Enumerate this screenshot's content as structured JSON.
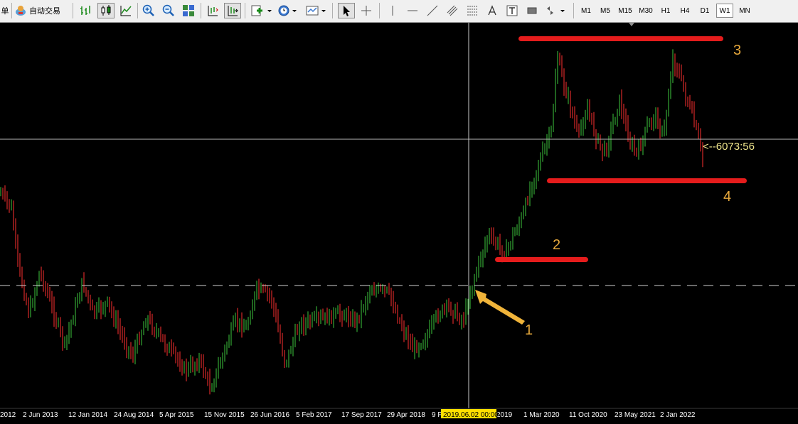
{
  "toolbar": {
    "menu_fragment": "单",
    "autotrade_label": "自动交易",
    "icons": [
      "autotrade-icon",
      "bar-chart-icon",
      "candlestick-icon",
      "line-chart-icon",
      "zoom-in-icon",
      "zoom-out-icon",
      "tile-windows-icon",
      "chart-shift-icon",
      "autoscroll-icon",
      "new-chart-icon",
      "periods-icon",
      "templates-icon",
      "cursor-icon",
      "crosshair-icon",
      "vertical-line-icon",
      "horizontal-line-icon",
      "trendline-icon",
      "equidistant-channel-icon",
      "fibonacci-icon",
      "text-icon",
      "text-label-icon",
      "rectangle-icon",
      "arrows-icon"
    ],
    "timeframes": [
      "M1",
      "M5",
      "M15",
      "M30",
      "H1",
      "H4",
      "D1",
      "W1",
      "MN"
    ],
    "active_timeframe": "W1"
  },
  "chart": {
    "price_marker": "<--6073:56",
    "crosshair_time_label": "2019.06.02 00:00",
    "x_axis_labels": [
      "2012",
      "2 Jun 2013",
      "12 Jan 2014",
      "24 Aug 2014",
      "5 Apr 2015",
      "15 Nov 2015",
      "26 Jun 2016",
      "5 Feb 2017",
      "17 Sep 2017",
      "29 Apr 2018",
      "9 F",
      "2019",
      "1 Mar 2020",
      "11 Oct 2020",
      "23 May 2021",
      "2 Jan 2022"
    ],
    "annotations": [
      "1",
      "2",
      "3",
      "4"
    ],
    "colors": {
      "background": "#000000",
      "bull_bar": "#3ec93e",
      "bear_bar": "#ff3030",
      "annotation_line": "#e51c1c",
      "annotation_text": "#e5a73c",
      "arrow": "#f0b43a",
      "crosshair": "#c8c8c8",
      "dashed_line": "#d0d0d0",
      "time_label_bg": "#ffe000"
    }
  }
}
